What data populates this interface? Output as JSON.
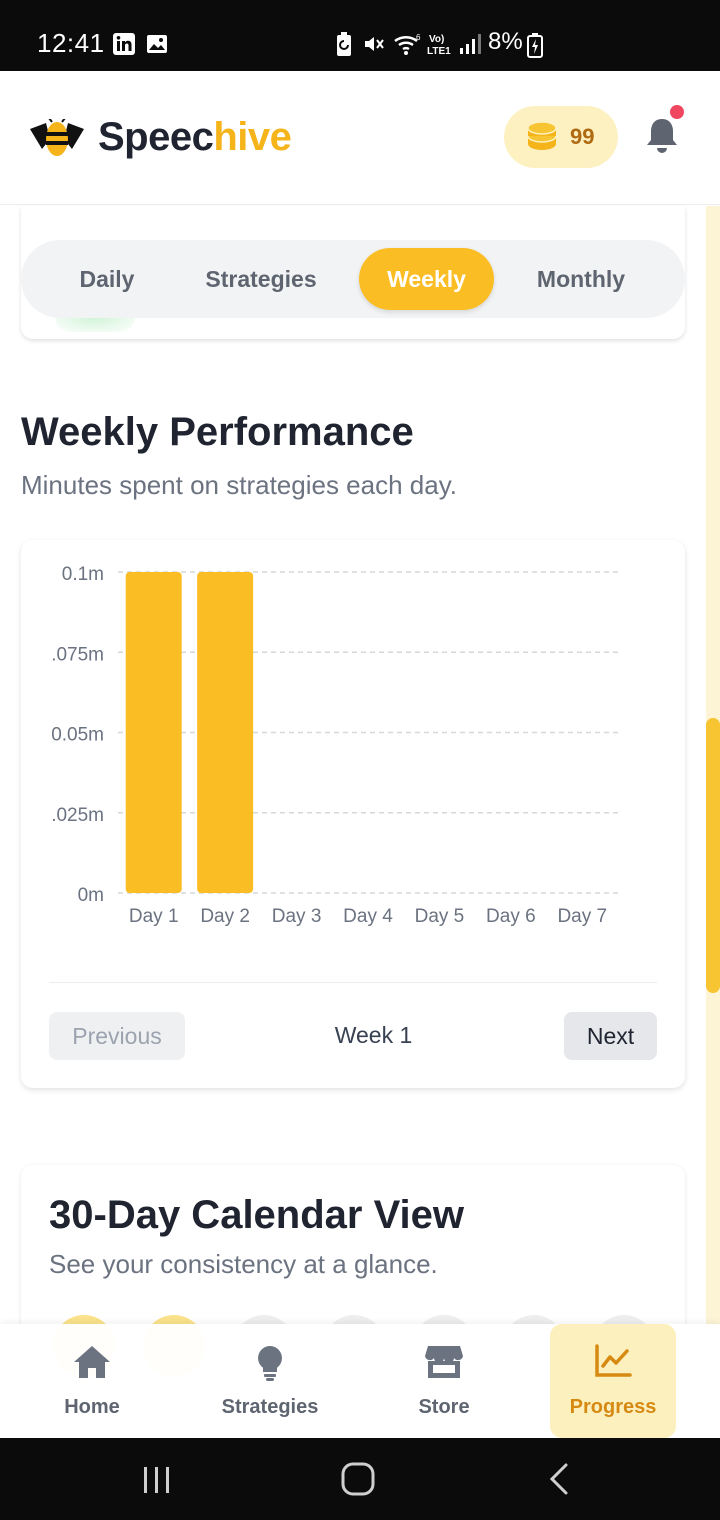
{
  "status_bar": {
    "time": "12:41",
    "battery_percent": "8%",
    "icons": [
      "linkedin-icon",
      "image-icon",
      "battery-saver-icon",
      "mute-icon",
      "wifi-icon",
      "volte-icon",
      "signal-icon",
      "battery-charging-icon"
    ]
  },
  "header": {
    "brand_first": "Speec",
    "brand_second": "hive",
    "coins": "99",
    "notification_dot": true
  },
  "tabs": [
    {
      "label": "Daily",
      "active": false
    },
    {
      "label": "Strategies",
      "active": false
    },
    {
      "label": "Weekly",
      "active": true
    },
    {
      "label": "Monthly",
      "active": false
    }
  ],
  "weekly": {
    "title": "Weekly Performance",
    "subtitle": "Minutes spent on strategies each day.",
    "prev_label": "Previous",
    "week_label": "Week 1",
    "next_label": "Next"
  },
  "chart_data": {
    "type": "bar",
    "categories": [
      "Day 1",
      "Day 2",
      "Day 3",
      "Day 4",
      "Day 5",
      "Day 6",
      "Day 7"
    ],
    "values": [
      0.1,
      0.1,
      0,
      0,
      0,
      0,
      0
    ],
    "y_ticks": [
      "0m",
      ".025m",
      "0.05m",
      ".075m",
      "0.1m"
    ],
    "ylim": [
      0,
      0.1
    ],
    "grid": true,
    "bar_color": "#fbbd24"
  },
  "calendar": {
    "title": "30-Day Calendar View",
    "subtitle": "See your consistency at a glance."
  },
  "bottom_nav": [
    {
      "label": "Home",
      "icon": "home-icon",
      "active": false
    },
    {
      "label": "Strategies",
      "icon": "lightbulb-icon",
      "active": false
    },
    {
      "label": "Store",
      "icon": "store-icon",
      "active": false
    },
    {
      "label": "Progress",
      "icon": "chart-line-icon",
      "active": true
    }
  ],
  "colors": {
    "accent": "#fbbd24",
    "accent_dark": "#d68a12",
    "text_dark": "#1f2430",
    "text_muted": "#6b7280"
  }
}
